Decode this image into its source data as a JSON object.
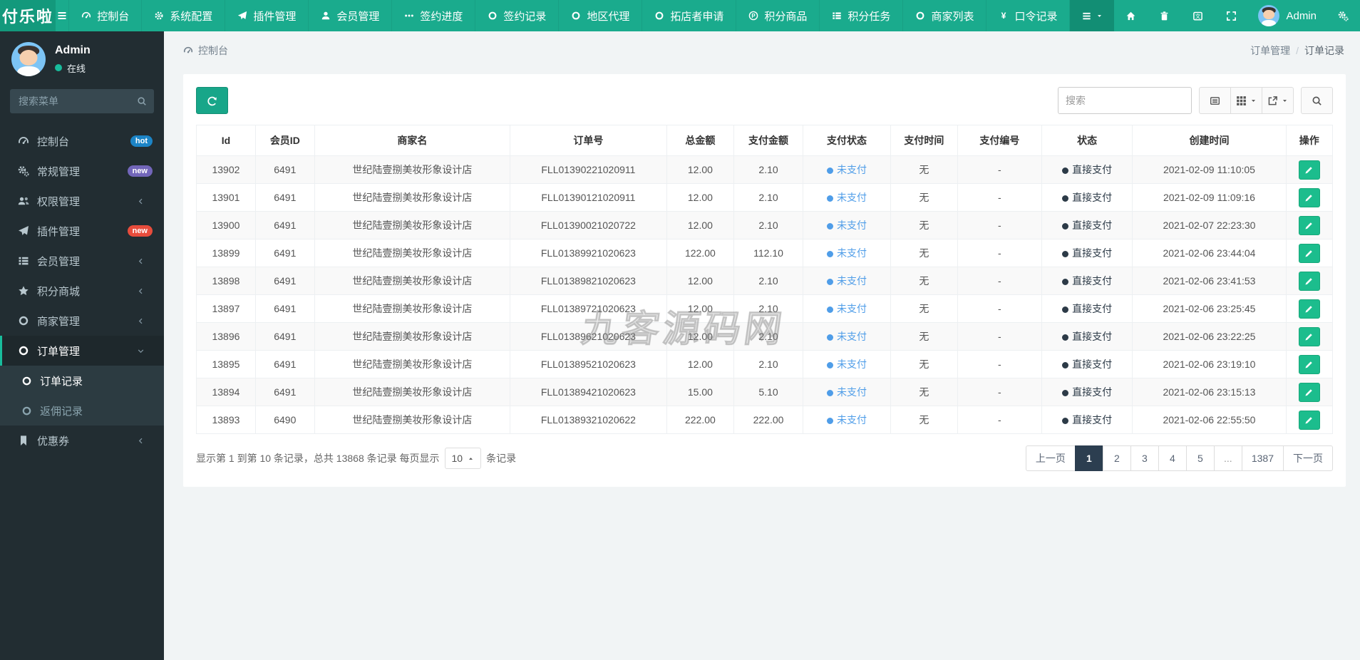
{
  "brand": {
    "logo": "付乐啦"
  },
  "topnav": {
    "items": [
      {
        "icon": "dashboard",
        "label": "控制台"
      },
      {
        "icon": "gear",
        "label": "系统配置"
      },
      {
        "icon": "plane",
        "label": "插件管理"
      },
      {
        "icon": "user",
        "label": "会员管理"
      },
      {
        "icon": "ellipsis",
        "label": "签约进度"
      },
      {
        "icon": "circle",
        "label": "签约记录"
      },
      {
        "icon": "circle",
        "label": "地区代理"
      },
      {
        "icon": "circle",
        "label": "拓店者申请"
      },
      {
        "icon": "product",
        "label": "积分商品"
      },
      {
        "icon": "tasks",
        "label": "积分任务"
      },
      {
        "icon": "circle",
        "label": "商家列表"
      },
      {
        "icon": "yen",
        "label": "口令记录"
      }
    ],
    "user": "Admin"
  },
  "sidebar": {
    "user": {
      "name": "Admin",
      "status": "在线"
    },
    "search_placeholder": "搜索菜单",
    "items": [
      {
        "icon": "dashboard",
        "label": "控制台",
        "badge": {
          "text": "hot",
          "color": "#1c84c6"
        }
      },
      {
        "icon": "cogs",
        "label": "常规管理",
        "badge": {
          "text": "new",
          "color": "#7266ba"
        }
      },
      {
        "icon": "users",
        "label": "权限管理",
        "chevron": "left"
      },
      {
        "icon": "plane",
        "label": "插件管理",
        "badge": {
          "text": "new",
          "color": "#e74c3c"
        }
      },
      {
        "icon": "tasks",
        "label": "会员管理",
        "chevron": "left"
      },
      {
        "icon": "star",
        "label": "积分商城",
        "chevron": "left"
      },
      {
        "icon": "circle",
        "label": "商家管理",
        "chevron": "left"
      },
      {
        "icon": "circle",
        "label": "订单管理",
        "chevron": "down",
        "active": true,
        "children": [
          {
            "label": "订单记录",
            "active": true
          },
          {
            "label": "返佣记录"
          }
        ]
      },
      {
        "icon": "bookmark",
        "label": "优惠券",
        "chevron": "left"
      }
    ]
  },
  "breadcrumb": {
    "left": "控制台",
    "right_parent": "订单管理",
    "right_separator": "/",
    "right_current": "订单记录"
  },
  "toolbar": {
    "search_placeholder": "搜索"
  },
  "table": {
    "columns": [
      "Id",
      "会员ID",
      "商家名",
      "订单号",
      "总金额",
      "支付金额",
      "支付状态",
      "支付时间",
      "支付编号",
      "状态",
      "创建时间",
      "操作"
    ],
    "rows": [
      {
        "id": "13902",
        "member_id": "6491",
        "merchant": "世纪陆壹捌美妆形象设计店",
        "order_no": "FLL01390221020911",
        "total": "12.00",
        "paid": "2.10",
        "pay_status": "未支付",
        "pay_time": "无",
        "pay_no": "-",
        "status": "直接支付",
        "created": "2021-02-09 11:10:05"
      },
      {
        "id": "13901",
        "member_id": "6491",
        "merchant": "世纪陆壹捌美妆形象设计店",
        "order_no": "FLL01390121020911",
        "total": "12.00",
        "paid": "2.10",
        "pay_status": "未支付",
        "pay_time": "无",
        "pay_no": "-",
        "status": "直接支付",
        "created": "2021-02-09 11:09:16"
      },
      {
        "id": "13900",
        "member_id": "6491",
        "merchant": "世纪陆壹捌美妆形象设计店",
        "order_no": "FLL01390021020722",
        "total": "12.00",
        "paid": "2.10",
        "pay_status": "未支付",
        "pay_time": "无",
        "pay_no": "-",
        "status": "直接支付",
        "created": "2021-02-07 22:23:30"
      },
      {
        "id": "13899",
        "member_id": "6491",
        "merchant": "世纪陆壹捌美妆形象设计店",
        "order_no": "FLL01389921020623",
        "total": "122.00",
        "paid": "112.10",
        "pay_status": "未支付",
        "pay_time": "无",
        "pay_no": "-",
        "status": "直接支付",
        "created": "2021-02-06 23:44:04"
      },
      {
        "id": "13898",
        "member_id": "6491",
        "merchant": "世纪陆壹捌美妆形象设计店",
        "order_no": "FLL01389821020623",
        "total": "12.00",
        "paid": "2.10",
        "pay_status": "未支付",
        "pay_time": "无",
        "pay_no": "-",
        "status": "直接支付",
        "created": "2021-02-06 23:41:53"
      },
      {
        "id": "13897",
        "member_id": "6491",
        "merchant": "世纪陆壹捌美妆形象设计店",
        "order_no": "FLL01389721020623",
        "total": "12.00",
        "paid": "2.10",
        "pay_status": "未支付",
        "pay_time": "无",
        "pay_no": "-",
        "status": "直接支付",
        "created": "2021-02-06 23:25:45"
      },
      {
        "id": "13896",
        "member_id": "6491",
        "merchant": "世纪陆壹捌美妆形象设计店",
        "order_no": "FLL01389621020623",
        "total": "12.00",
        "paid": "2.10",
        "pay_status": "未支付",
        "pay_time": "无",
        "pay_no": "-",
        "status": "直接支付",
        "created": "2021-02-06 23:22:25"
      },
      {
        "id": "13895",
        "member_id": "6491",
        "merchant": "世纪陆壹捌美妆形象设计店",
        "order_no": "FLL01389521020623",
        "total": "12.00",
        "paid": "2.10",
        "pay_status": "未支付",
        "pay_time": "无",
        "pay_no": "-",
        "status": "直接支付",
        "created": "2021-02-06 23:19:10"
      },
      {
        "id": "13894",
        "member_id": "6491",
        "merchant": "世纪陆壹捌美妆形象设计店",
        "order_no": "FLL01389421020623",
        "total": "15.00",
        "paid": "5.10",
        "pay_status": "未支付",
        "pay_time": "无",
        "pay_no": "-",
        "status": "直接支付",
        "created": "2021-02-06 23:15:13"
      },
      {
        "id": "13893",
        "member_id": "6490",
        "merchant": "世纪陆壹捌美妆形象设计店",
        "order_no": "FLL01389321020622",
        "total": "222.00",
        "paid": "222.00",
        "pay_status": "未支付",
        "pay_time": "无",
        "pay_no": "-",
        "status": "直接支付",
        "created": "2021-02-06 22:55:50"
      }
    ]
  },
  "pagination": {
    "summary_prefix": "显示第 1 到第 10 条记录，总共 13868 条记录 每页显示",
    "page_size": "10",
    "summary_suffix": "条记录",
    "prev": "上一页",
    "next": "下一页",
    "pages": [
      "1",
      "2",
      "3",
      "4",
      "5",
      "...",
      "1387"
    ],
    "active_page": "1"
  },
  "watermark": "九客源码网",
  "colors": {
    "navbar": "#1aab8d",
    "navbar_dark": "#13997c",
    "sidebar": "#222d32",
    "accent": "#18bc9c",
    "badge_hot_blue": "#1c84c6",
    "badge_new_purple": "#7266ba",
    "badge_new_red": "#e74c3c",
    "pay_status_blue": "#4f9de8",
    "status_dark": "#2c3a47",
    "edit_button_green": "#1cbd8d",
    "active_page_bg": "#2c3e50"
  }
}
